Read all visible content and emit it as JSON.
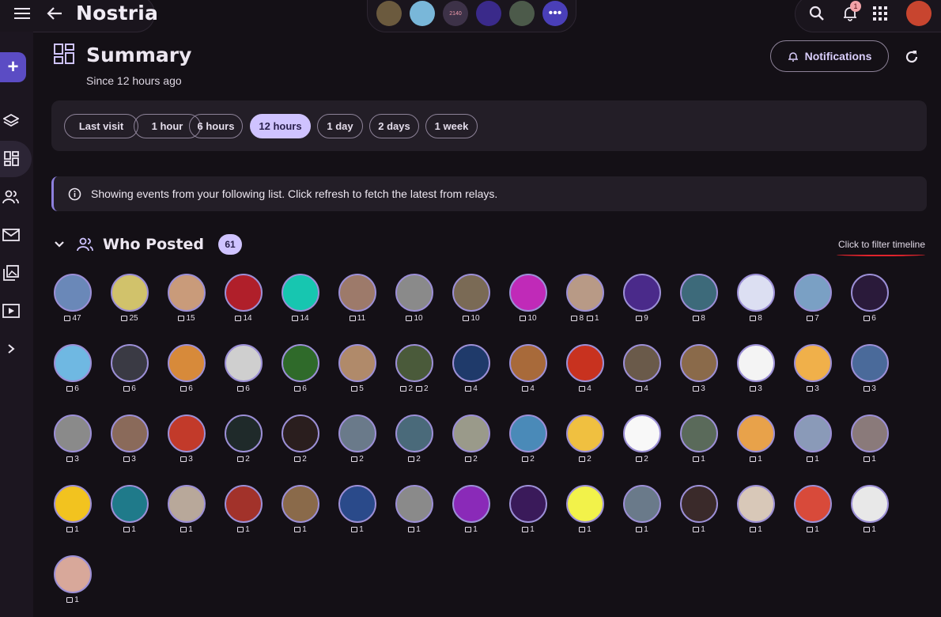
{
  "app": {
    "title": "Nostria"
  },
  "topbar": {
    "favorites": [
      {
        "label": "",
        "color": "#6b5a3e"
      },
      {
        "label": "",
        "color": "#79b7d9"
      },
      {
        "label": "2140",
        "color": "#3d3248"
      },
      {
        "label": "",
        "color": "#3a2a8a"
      },
      {
        "label": "",
        "color": "#4c5a4a"
      }
    ],
    "more_icon": "more-horizontal-icon",
    "notification_count": "1"
  },
  "page": {
    "title": "Summary",
    "subtitle": "Since 12 hours ago",
    "notifications_button": "Notifications"
  },
  "time_filters": [
    {
      "label": "Last visit",
      "selected": false
    },
    {
      "label": "1 hour",
      "selected": false
    },
    {
      "label": "6 hours",
      "selected": false
    },
    {
      "label": "12 hours",
      "selected": true
    },
    {
      "label": "1 day",
      "selected": false
    },
    {
      "label": "2 days",
      "selected": false
    },
    {
      "label": "1 week",
      "selected": false
    }
  ],
  "info": {
    "text": "Showing events from your following list. Click refresh to fetch the latest from relays."
  },
  "who_posted": {
    "title": "Who Posted",
    "count": "61",
    "hint": "Click to filter timeline",
    "posters": [
      {
        "c": "#6a88b8",
        "p": "47"
      },
      {
        "c": "#d1c26b",
        "p": "25"
      },
      {
        "c": "#c99b7a",
        "p": "15"
      },
      {
        "c": "#b01f2a",
        "p": "14"
      },
      {
        "c": "#17c6b0",
        "p": "14"
      },
      {
        "c": "#9d7a6a",
        "p": "11"
      },
      {
        "c": "#8a8a8a",
        "p": "10"
      },
      {
        "c": "#7a6a55",
        "p": "10"
      },
      {
        "c": "#c02ab8",
        "p": "10"
      },
      {
        "c": "#b89a86",
        "p": "8",
        "a": "1"
      },
      {
        "c": "#4a2a8a",
        "p": "9"
      },
      {
        "c": "#3d6a7a",
        "p": "8"
      },
      {
        "c": "#dcdff2",
        "p": "8"
      },
      {
        "c": "#7aa0c4",
        "p": "7"
      },
      {
        "c": "#2a1a3a",
        "p": "6"
      },
      {
        "c": "#6fb8e2",
        "p": "6"
      },
      {
        "c": "#3a3a44",
        "p": "6"
      },
      {
        "c": "#d78a3a",
        "p": "6"
      },
      {
        "c": "#cfcfcf",
        "p": "6"
      },
      {
        "c": "#2f6a2a",
        "p": "6"
      },
      {
        "c": "#b08a6a",
        "p": "5"
      },
      {
        "c": "#4a5a3a",
        "p": "2",
        "a": "2"
      },
      {
        "c": "#1f3a6a",
        "p": "4"
      },
      {
        "c": "#a86a3a",
        "p": "4"
      },
      {
        "c": "#c8321f",
        "p": "4"
      },
      {
        "c": "#6a5a4a",
        "p": "4"
      },
      {
        "c": "#8a6a4a",
        "p": "3"
      },
      {
        "c": "#f4f4f4",
        "p": "3"
      },
      {
        "c": "#f0b04a",
        "p": "3"
      },
      {
        "c": "#4a6a9a",
        "p": "3"
      },
      {
        "c": "#8a8a8a",
        "p": "3"
      },
      {
        "c": "#8a6a5a",
        "p": "3"
      },
      {
        "c": "#c23a2a",
        "p": "3"
      },
      {
        "c": "#1f2a2a",
        "p": "2"
      },
      {
        "c": "#2a1e1e",
        "p": "2"
      },
      {
        "c": "#6a7a8a",
        "p": "2"
      },
      {
        "c": "#4a6a7a",
        "p": "2"
      },
      {
        "c": "#9a9a8a",
        "p": "2"
      },
      {
        "c": "#4a8ab8",
        "p": "2"
      },
      {
        "c": "#f0c040",
        "p": "2"
      },
      {
        "c": "#f8f8f8",
        "p": "2"
      },
      {
        "c": "#5a6a5a",
        "p": "1"
      },
      {
        "c": "#e8a24a",
        "p": "1"
      },
      {
        "c": "#8a9ab8",
        "p": "1"
      },
      {
        "c": "#8a7a7a",
        "p": "1"
      },
      {
        "c": "#f2c31f",
        "p": "1"
      },
      {
        "c": "#1f7a8a",
        "p": "1"
      },
      {
        "c": "#b8a89a",
        "p": "1"
      },
      {
        "c": "#a2322a",
        "p": "1"
      },
      {
        "c": "#8a6a4a",
        "p": "1"
      },
      {
        "c": "#2a4a8a",
        "p": "1"
      },
      {
        "c": "#8a8a8a",
        "p": "1"
      },
      {
        "c": "#8a2ab8",
        "p": "1"
      },
      {
        "c": "#3a1a5a",
        "p": "1"
      },
      {
        "c": "#f2f24a",
        "p": "1"
      },
      {
        "c": "#6a7a8a",
        "p": "1"
      },
      {
        "c": "#3a2a2a",
        "p": "1"
      },
      {
        "c": "#d8c8b8",
        "p": "1"
      },
      {
        "c": "#d84a3a",
        "p": "1"
      },
      {
        "c": "#e8e8e8",
        "p": "1"
      },
      {
        "c": "#d8a89a",
        "p": "1"
      }
    ]
  },
  "colors": {
    "accent": "#cfc3ff",
    "brand": "#5b4cc4",
    "highlight": "#e0232c"
  }
}
